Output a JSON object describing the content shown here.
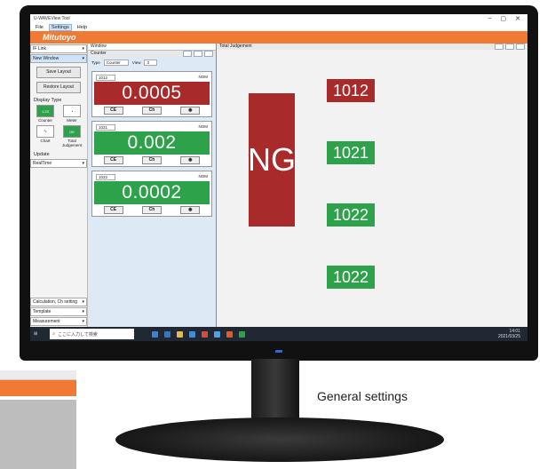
{
  "app": {
    "title": "U-WAVEView Tool",
    "menu": [
      "File",
      "Settings",
      "Help"
    ],
    "brand": "Mitutoyo"
  },
  "left_panel": {
    "unit_dropdown": "IF Link",
    "new_window": "New Window",
    "save_layout": "Save Layout",
    "restore_layout": "Restore Layout",
    "display_type_label": "Display Type",
    "display_types": [
      {
        "label": "Counter",
        "icon": "counter-icon"
      },
      {
        "label": "Meter",
        "icon": "meter-icon"
      },
      {
        "label": "Chart",
        "icon": "chart-icon"
      },
      {
        "label": "Total Judgement",
        "icon": "judgement-icon"
      }
    ],
    "update_label": "Update",
    "update_value": "RealTime",
    "bottom_items": [
      "Calculation, Ch setting",
      "Template",
      "Measurement"
    ]
  },
  "counter_window": {
    "tab": "Window",
    "title": "Counter",
    "type_label": "Type",
    "type_value": "Counter",
    "view_label": "View",
    "view_value": "3",
    "counters": [
      {
        "channel": "1012",
        "tag": "NOM",
        "value": "0.0005",
        "status": "red"
      },
      {
        "channel": "1021",
        "tag": "NOM",
        "value": "0.002",
        "status": "green"
      },
      {
        "channel": "1022",
        "tag": "NOM",
        "value": "0.0002",
        "status": "green"
      }
    ],
    "buttons": [
      "CE",
      "Ch",
      "Eye"
    ]
  },
  "judgement_window": {
    "title": "Total Judgement",
    "overall": "NG",
    "items": [
      {
        "label": "1012",
        "status": "red"
      },
      {
        "label": "1021",
        "status": "green"
      },
      {
        "label": "1022",
        "status": "green"
      },
      {
        "label": "1022",
        "status": "green"
      }
    ]
  },
  "taskbar": {
    "search_placeholder": "ここに入力して検索",
    "time": "14:01",
    "date": "2021/03/25"
  },
  "caption": "General settings",
  "colors": {
    "brand_orange": "#f07a34",
    "ng_red": "#a82a2a",
    "ok_green": "#2ea24a"
  }
}
